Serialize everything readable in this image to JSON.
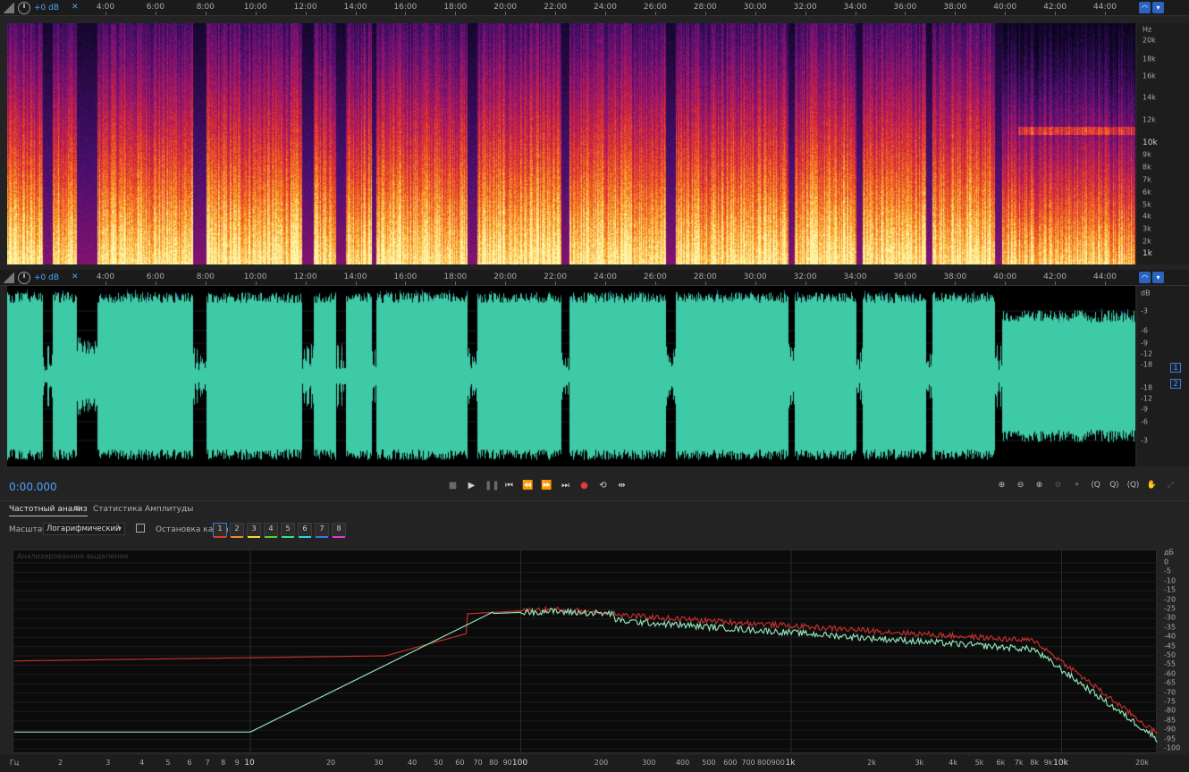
{
  "spectral_ruler": {
    "gain": "+0 dB",
    "ticks": [
      "4:00",
      "6:00",
      "8:00",
      "10:00",
      "12:00",
      "14:00",
      "16:00",
      "18:00",
      "20:00",
      "22:00",
      "24:00",
      "26:00",
      "28:00",
      "30:00",
      "32:00",
      "34:00",
      "36:00",
      "38:00",
      "40:00",
      "42:00",
      "44:00"
    ]
  },
  "spectrogram": {
    "axis_unit": "Hz",
    "freq_labels": [
      "20k",
      "18k",
      "16k",
      "14k",
      "12k",
      "10k",
      "9k",
      "8k",
      "7k",
      "6k",
      "5k",
      "4k",
      "3k",
      "2k",
      "1k"
    ]
  },
  "waveform_ruler": {
    "gain": "+0 dB",
    "ticks": [
      "4:00",
      "6:00",
      "8:00",
      "10:00",
      "12:00",
      "14:00",
      "16:00",
      "18:00",
      "20:00",
      "22:00",
      "24:00",
      "26:00",
      "28:00",
      "30:00",
      "32:00",
      "34:00",
      "36:00",
      "38:00",
      "40:00",
      "42:00",
      "44:00"
    ]
  },
  "waveform": {
    "axis_unit": "dB",
    "db_labels": [
      "-3",
      "-6",
      "-9",
      "-12",
      "-18",
      "-18",
      "-12",
      "-9",
      "-6",
      "-3"
    ],
    "channel_1": "1",
    "channel_2": "2",
    "color": "#3ec9a7"
  },
  "transport": {
    "timecode": "0:00.000",
    "buttons": [
      "stop",
      "play",
      "pause",
      "go-to-start",
      "rewind",
      "fast-forward",
      "go-to-end",
      "record",
      "loop",
      "skip-selection"
    ]
  },
  "analysis_panel": {
    "tab_frequency": "Частотный анализ",
    "tab_amplitude": "Статистика Амплитуды",
    "scale_label": "Масштаб:",
    "scale_value": "Логарифмический",
    "freeze_label": "Остановка кадра:",
    "frames": [
      {
        "num": "1",
        "color": "#e03a2c"
      },
      {
        "num": "2",
        "color": "#f08a2a"
      },
      {
        "num": "3",
        "color": "#f0e02a"
      },
      {
        "num": "4",
        "color": "#4ad63a"
      },
      {
        "num": "5",
        "color": "#3adf8a"
      },
      {
        "num": "6",
        "color": "#2ad6e0"
      },
      {
        "num": "7",
        "color": "#3a7ae0"
      },
      {
        "num": "8",
        "color": "#e03ad6"
      }
    ],
    "graph_title": "Анализированное выделение",
    "db_unit": "дБ",
    "db_labels": [
      "0",
      "-5",
      "-10",
      "-15",
      "-20",
      "-25",
      "-30",
      "-35",
      "-40",
      "-45",
      "-50",
      "-55",
      "-60",
      "-65",
      "-70",
      "-75",
      "-80",
      "-85",
      "-90",
      "-95",
      "-100"
    ],
    "freq_unit": "Гц",
    "freq_labels": [
      "2",
      "3",
      "4",
      "5",
      "6",
      "7",
      "8",
      "9",
      "10",
      "20",
      "30",
      "40",
      "50",
      "60",
      "70",
      "80",
      "90",
      "100",
      "200",
      "300",
      "400",
      "500",
      "600",
      "700",
      "800",
      "900",
      "1k",
      "2k",
      "3k",
      "4k",
      "5k",
      "6k",
      "7k",
      "8k",
      "9k",
      "10k",
      "20k"
    ],
    "series_colors": [
      "#c0302a",
      "#8fe0b8"
    ]
  }
}
